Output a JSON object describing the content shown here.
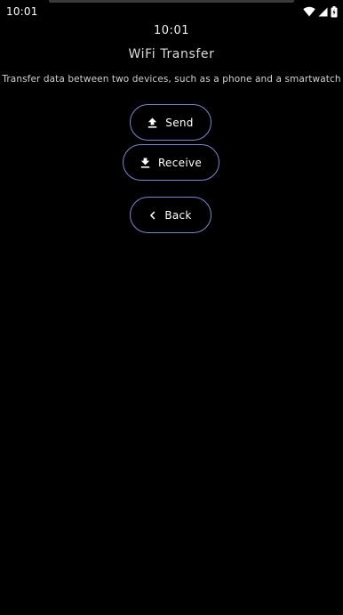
{
  "status_bar": {
    "time": "10:01",
    "icons": [
      "wifi-icon",
      "cell-signal-icon",
      "battery-charging-icon"
    ]
  },
  "screen": {
    "clock": "10:01",
    "title": "WiFi Transfer",
    "description": "Transfer data between two devices, such as a phone and a smartwatch"
  },
  "buttons": {
    "send": {
      "label": "Send",
      "icon": "upload-icon"
    },
    "receive": {
      "label": "Receive",
      "icon": "download-icon"
    },
    "back": {
      "label": "Back",
      "icon": "chevron-left-icon"
    }
  },
  "colors": {
    "background": "#000000",
    "button_border": "#7b84d6",
    "text": "#ffffff"
  }
}
